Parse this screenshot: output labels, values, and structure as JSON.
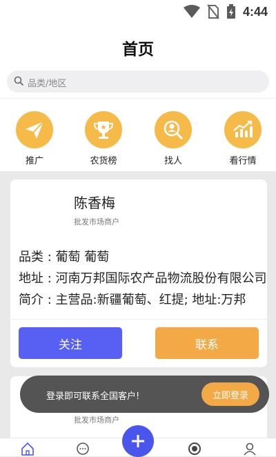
{
  "status": {
    "time": "4:44"
  },
  "header": {
    "title": "首页"
  },
  "search": {
    "placeholder": "品类/地区"
  },
  "quick": [
    {
      "label": "推广",
      "icon": "paper-plane-icon"
    },
    {
      "label": "农货榜",
      "icon": "trophy-icon"
    },
    {
      "label": "找人",
      "icon": "find-person-icon"
    },
    {
      "label": "看行情",
      "icon": "market-trend-icon"
    }
  ],
  "cards": [
    {
      "name": "陈香梅",
      "role": "批发市场商户",
      "category": "品类 : 葡萄 葡萄",
      "address": "地址 : 河南万邦国际农产品物流股份有限公司",
      "intro": "简介 : 主营品:新疆葡萄、红提; 地址:万邦",
      "follow": "关注",
      "contact": "联系"
    },
    {
      "role": "批发市场商户"
    }
  ],
  "toast": {
    "text": "登录即可联系全国客户!",
    "button": "立即登录"
  },
  "tabs": [
    "home-icon",
    "message-icon",
    "add-icon",
    "shutter-icon",
    "profile-icon"
  ],
  "colors": {
    "accent_orange": "#f3a945",
    "accent_blue": "#5760f2",
    "icon_yellow": "#f6ba49"
  }
}
